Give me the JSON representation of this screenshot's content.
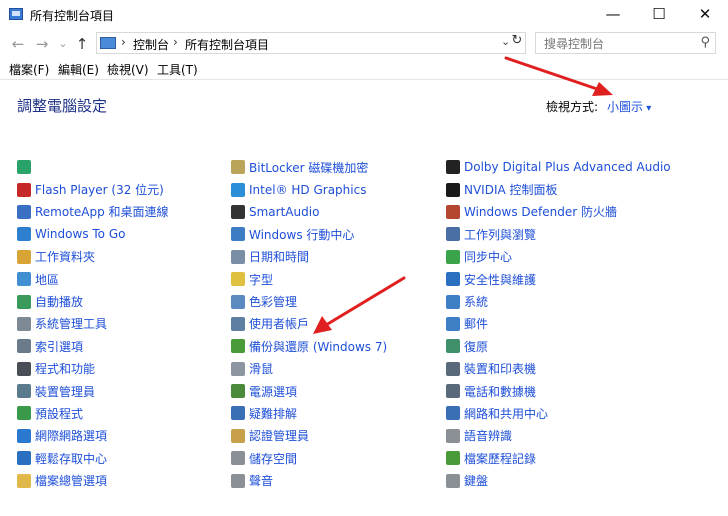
{
  "window": {
    "title": "所有控制台項目",
    "minimize": "—",
    "maximize": "☐",
    "close": "✕"
  },
  "nav": {
    "back": "←",
    "forward": "→",
    "recent": "⌄",
    "up": "↑"
  },
  "address": {
    "crumb1": "控制台",
    "crumb2": "所有控制台項目",
    "sep": "›"
  },
  "search": {
    "placeholder": "搜尋控制台",
    "icon": "⚲"
  },
  "menu": {
    "file": "檔案(F)",
    "edit": "編輯(E)",
    "view": "檢視(V)",
    "tools": "工具(T)"
  },
  "main": {
    "heading": "調整電腦設定",
    "view_by_label": "檢視方式:",
    "view_by_value": "小圖示"
  },
  "colors": {
    "link": "#1e4fd8",
    "heading": "#1e3287",
    "arrow": "#e02020"
  },
  "columns": [
    [
      {
        "label": "",
        "icon": "network-share-icon",
        "color": "#2aa36a"
      },
      {
        "label": "Flash Player (32 位元)",
        "icon": "flash-icon",
        "color": "#c62828"
      },
      {
        "label": "RemoteApp 和桌面連線",
        "icon": "remoteapp-icon",
        "color": "#3b6fc2"
      },
      {
        "label": "Windows To Go",
        "icon": "windows-to-go-icon",
        "color": "#2f7fd1"
      },
      {
        "label": "工作資料夾",
        "icon": "work-folders-icon",
        "color": "#d8a437"
      },
      {
        "label": "地區",
        "icon": "region-icon",
        "color": "#3f8fd2"
      },
      {
        "label": "自動播放",
        "icon": "autoplay-icon",
        "color": "#3a9a5a"
      },
      {
        "label": "系統管理工具",
        "icon": "admin-tools-icon",
        "color": "#7d8a96"
      },
      {
        "label": "索引選項",
        "icon": "indexing-icon",
        "color": "#6b7b8c"
      },
      {
        "label": "程式和功能",
        "icon": "programs-icon",
        "color": "#4a4f57"
      },
      {
        "label": "裝置管理員",
        "icon": "device-manager-icon",
        "color": "#5a7a8e"
      },
      {
        "label": "預設程式",
        "icon": "default-programs-icon",
        "color": "#3a9a4a"
      },
      {
        "label": "網際網路選項",
        "icon": "internet-options-icon",
        "color": "#2a78d0"
      },
      {
        "label": "輕鬆存取中心",
        "icon": "ease-of-access-icon",
        "color": "#2a6fc0"
      },
      {
        "label": "檔案總管選項",
        "icon": "explorer-options-icon",
        "color": "#e0b84a"
      }
    ],
    [
      {
        "label": "BitLocker 磁碟機加密",
        "icon": "bitlocker-icon",
        "color": "#b9a45a"
      },
      {
        "label": "Intel® HD Graphics",
        "icon": "intel-graphics-icon",
        "color": "#2a8fd6"
      },
      {
        "label": "SmartAudio",
        "icon": "smartaudio-icon",
        "color": "#333333"
      },
      {
        "label": "Windows 行動中心",
        "icon": "mobility-center-icon",
        "color": "#3b7cc5"
      },
      {
        "label": "日期和時間",
        "icon": "date-time-icon",
        "color": "#7a8fa5"
      },
      {
        "label": "字型",
        "icon": "fonts-icon",
        "color": "#e0c040"
      },
      {
        "label": "色彩管理",
        "icon": "color-management-icon",
        "color": "#5a8ac0"
      },
      {
        "label": "使用者帳戶",
        "icon": "user-accounts-icon",
        "color": "#5e7fa2"
      },
      {
        "label": "備份與還原 (Windows 7)",
        "icon": "backup-restore-icon",
        "color": "#4a9a3a"
      },
      {
        "label": "滑鼠",
        "icon": "mouse-icon",
        "color": "#8c96a0"
      },
      {
        "label": "電源選項",
        "icon": "power-options-icon",
        "color": "#4a8a3a"
      },
      {
        "label": "疑難排解",
        "icon": "troubleshooting-icon",
        "color": "#3a6fb5"
      },
      {
        "label": "認證管理員",
        "icon": "credential-manager-icon",
        "color": "#c8a04a"
      },
      {
        "label": "儲存空間",
        "icon": "storage-spaces-icon",
        "color": "#8a9096"
      },
      {
        "label": "聲音",
        "icon": "sound-icon",
        "color": "#8a9096"
      }
    ],
    [
      {
        "label": "Dolby Digital Plus Advanced Audio",
        "icon": "dolby-icon",
        "color": "#222222"
      },
      {
        "label": "NVIDIA 控制面板",
        "icon": "nvidia-icon",
        "color": "#1a1a1a"
      },
      {
        "label": "Windows Defender 防火牆",
        "icon": "firewall-icon",
        "color": "#b5462f"
      },
      {
        "label": "工作列與瀏覽",
        "icon": "taskbar-icon",
        "color": "#4a6fa5"
      },
      {
        "label": "同步中心",
        "icon": "sync-center-icon",
        "color": "#3aa44a"
      },
      {
        "label": "安全性與維護",
        "icon": "security-maintenance-icon",
        "color": "#2a6fc0"
      },
      {
        "label": "系統",
        "icon": "system-icon",
        "color": "#3f7fc5"
      },
      {
        "label": "郵件",
        "icon": "mail-icon",
        "color": "#3f7fc5"
      },
      {
        "label": "復原",
        "icon": "recovery-icon",
        "color": "#3f8f6a"
      },
      {
        "label": "裝置和印表機",
        "icon": "devices-printers-icon",
        "color": "#5a6a7a"
      },
      {
        "label": "電話和數據機",
        "icon": "phone-modem-icon",
        "color": "#5a6a7a"
      },
      {
        "label": "網路和共用中心",
        "icon": "network-sharing-icon",
        "color": "#3a6fb5"
      },
      {
        "label": "語音辨識",
        "icon": "speech-recognition-icon",
        "color": "#8a9096"
      },
      {
        "label": "檔案歷程記錄",
        "icon": "file-history-icon",
        "color": "#4a9a3a"
      },
      {
        "label": "鍵盤",
        "icon": "keyboard-icon",
        "color": "#8a9096"
      }
    ]
  ]
}
